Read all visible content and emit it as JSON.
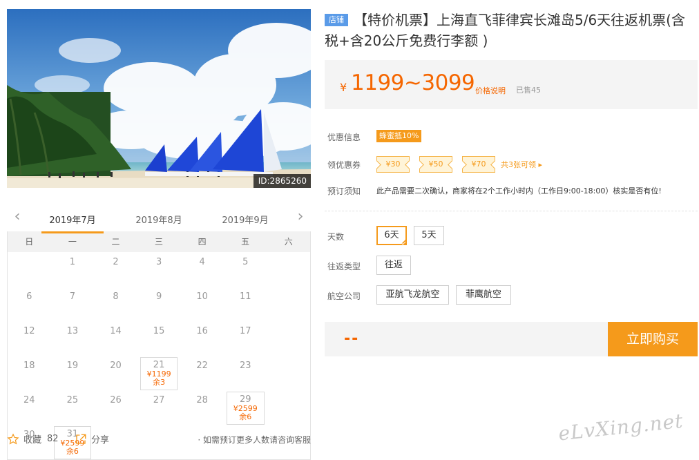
{
  "hero": {
    "image_id": "ID:2865260"
  },
  "calendar": {
    "months": [
      "2019年7月",
      "2019年8月",
      "2019年9月"
    ],
    "active_month_index": 0,
    "weekdays": [
      "日",
      "一",
      "二",
      "三",
      "四",
      "五",
      "六"
    ],
    "cells": [
      {
        "day": "",
        "price": "",
        "remain": ""
      },
      {
        "day": "1",
        "price": "",
        "remain": ""
      },
      {
        "day": "2",
        "price": "",
        "remain": ""
      },
      {
        "day": "3",
        "price": "",
        "remain": ""
      },
      {
        "day": "4",
        "price": "",
        "remain": ""
      },
      {
        "day": "5",
        "price": "",
        "remain": ""
      },
      {
        "day": "6",
        "price": "",
        "remain": ""
      },
      {
        "day": "7",
        "price": "",
        "remain": ""
      },
      {
        "day": "8",
        "price": "",
        "remain": ""
      },
      {
        "day": "9",
        "price": "",
        "remain": ""
      },
      {
        "day": "10",
        "price": "",
        "remain": ""
      },
      {
        "day": "11",
        "price": "",
        "remain": ""
      },
      {
        "day": "12",
        "price": "",
        "remain": ""
      },
      {
        "day": "13",
        "price": "",
        "remain": ""
      },
      {
        "day": "14",
        "price": "",
        "remain": ""
      },
      {
        "day": "15",
        "price": "",
        "remain": ""
      },
      {
        "day": "16",
        "price": "",
        "remain": ""
      },
      {
        "day": "17",
        "price": "",
        "remain": ""
      },
      {
        "day": "18",
        "price": "",
        "remain": ""
      },
      {
        "day": "19",
        "price": "",
        "remain": ""
      },
      {
        "day": "20",
        "price": "",
        "remain": ""
      },
      {
        "day": "21",
        "price": "¥1199",
        "remain": "余3"
      },
      {
        "day": "22",
        "price": "",
        "remain": ""
      },
      {
        "day": "23",
        "price": "",
        "remain": ""
      },
      {
        "day": "24",
        "price": "",
        "remain": ""
      },
      {
        "day": "25",
        "price": "",
        "remain": ""
      },
      {
        "day": "26",
        "price": "",
        "remain": ""
      },
      {
        "day": "27",
        "price": "",
        "remain": ""
      },
      {
        "day": "28",
        "price": "",
        "remain": ""
      },
      {
        "day": "29",
        "price": "¥2599",
        "remain": "余6"
      },
      {
        "day": "30",
        "price": "",
        "remain": ""
      },
      {
        "day": "31",
        "price": "¥2599",
        "remain": "余6"
      }
    ]
  },
  "share": {
    "fav_label": "收藏",
    "fav_count": "82",
    "share_label": "分享",
    "note": "· 如需预订更多人数请咨询客服"
  },
  "product": {
    "shop_tag": "店铺",
    "title": "【特价机票】上海直飞菲律宾长滩岛5/6天往返机票(含税+含20公斤免费行李额 )",
    "price_symbol": "¥",
    "price_range": "1199~3099",
    "price_explain": "价格说明",
    "sold": "已售45",
    "promo_label": "优惠信息",
    "promo_badge": "蜂蜜抵10%",
    "coupon_label": "领优惠券",
    "coupons": [
      "¥30",
      "¥50",
      "¥70"
    ],
    "coupon_more": "共3张可领 ▸",
    "notice_label": "预订须知",
    "notice_text": "此产品需要二次确认，商家将在2个工作小时内（工作日9:00-18:00）核实是否有位!",
    "days_label": "天数",
    "days_options": [
      "6天",
      "5天"
    ],
    "trip_label": "往返类型",
    "trip_options": [
      "往返"
    ],
    "airline_label": "航空公司",
    "airline_options": [
      "亚航飞龙航空",
      "菲鹰航空"
    ],
    "total_placeholder": "--",
    "buy_label": "立即购买"
  },
  "colors": {
    "accent_orange": "#f59a1b",
    "price_orange": "#f56600",
    "shop_tag_blue": "#5a9be8"
  },
  "watermark": "eLvXing.net"
}
